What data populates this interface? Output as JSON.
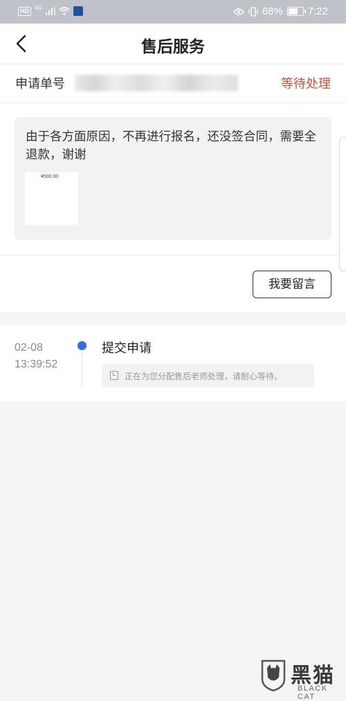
{
  "status_bar": {
    "hd": "HD",
    "network": "4G",
    "battery_percent": "68%",
    "battery_level": 0.68,
    "time": "7:22"
  },
  "header": {
    "title": "售后服务"
  },
  "order": {
    "label": "申请单号",
    "status": "等待处理"
  },
  "message": {
    "text": "由于各方面原因，不再进行报名，还没签合同，需要全退款，谢谢",
    "image_text": "¥500.00",
    "leave_message_button": "我要留言"
  },
  "timeline": [
    {
      "date": "02-08",
      "time": "13:39:52",
      "title": "提交申请",
      "note": "正在为您分配售后老师处理，请耐心等待。"
    }
  ],
  "watermark": {
    "cn": "黑猫",
    "en": "BLACK CAT"
  },
  "colors": {
    "accent_red": "#d94b3a",
    "timeline_blue": "#2f6fe3"
  }
}
